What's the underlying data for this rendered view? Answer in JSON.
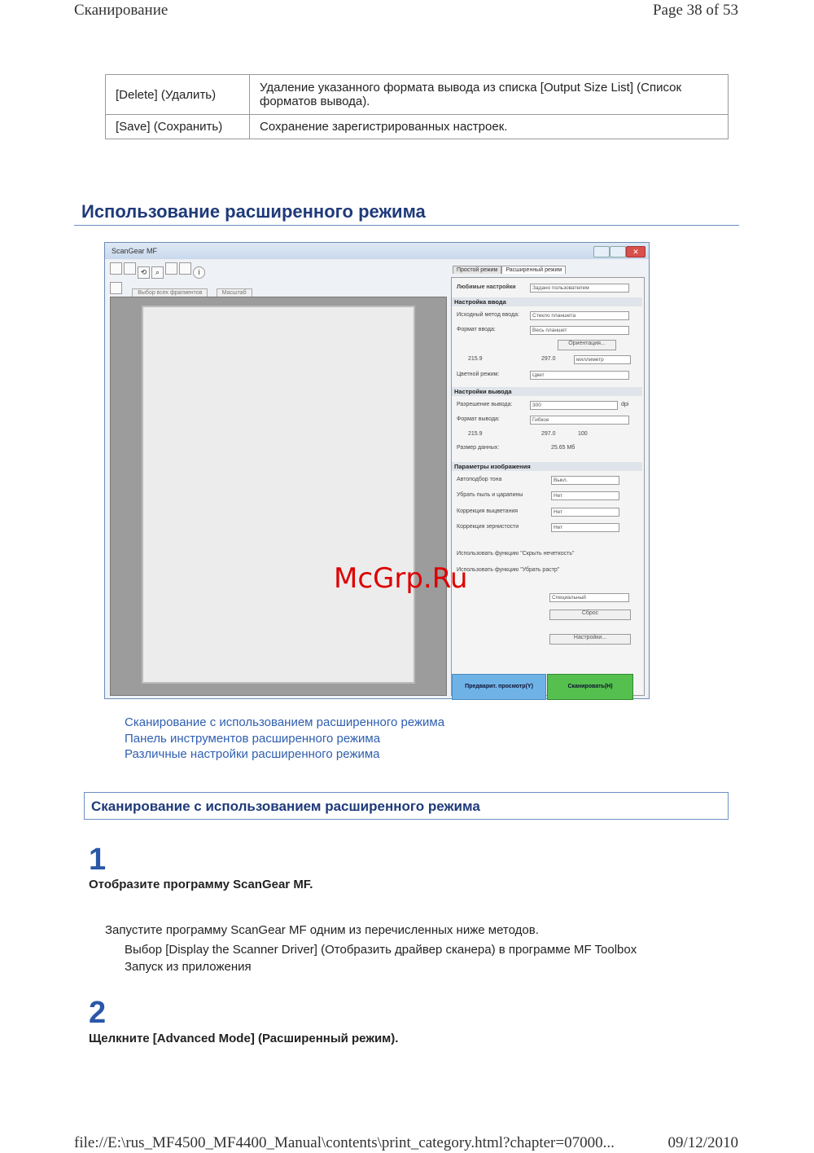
{
  "header": {
    "left": "Сканирование",
    "right": "Page 38 of 53"
  },
  "options_table": [
    {
      "name": "[Delete] (Удалить)",
      "desc": "Удаление указанного формата вывода из списка [Output Size List] (Список форматов вывода)."
    },
    {
      "name": "[Save] (Сохранить)",
      "desc": "Сохранение зарегистрированных настроек."
    }
  ],
  "section_title": "Использование расширенного режима",
  "window": {
    "title": "ScanGear MF",
    "toolbar2": [
      "Выбор всех фрагментов",
      "Масштаб"
    ],
    "tabs": [
      "Простой режим",
      "Расширенный режим"
    ],
    "fav_label": "Любимые настройки",
    "fav_value": "Задано пользователем",
    "input_group": "Настройка ввода",
    "input_method_label": "Исходный метод ввода:",
    "input_method_value": "Стекло планшета",
    "input_size_label": "Формат ввода:",
    "input_size_value": "Весь планшет",
    "orientation_btn": "Ориентация...",
    "width_in": "215.9",
    "height_in": "297.0",
    "unit_value": "миллиметр",
    "color_mode_label": "Цветной режим:",
    "color_mode_value": "Цвет",
    "output_group": "Настройки вывода",
    "res_label": "Разрешение вывода:",
    "res_value": "300",
    "res_unit": "dpi",
    "out_size_label": "Формат вывода:",
    "out_size_value": "Гибкое",
    "width_out": "215.9",
    "height_out": "297.0",
    "scale_value": "100",
    "data_size_label": "Размер данных:",
    "data_size_value": "25.65 Мб",
    "image_group": "Параметры изображения",
    "auto_tone_label": "Автоподбор тона",
    "auto_tone_value": "Выкл.",
    "descreen_label": "Убрать пыль и царапины",
    "descreen_value": "Нет",
    "fade_label": "Коррекция выцветания",
    "fade_value": "Нет",
    "grain_label": "Коррекция зернистости",
    "grain_value": "Нет",
    "unsharp_label": "Использовать функцию \"Скрыть нечеткость\"",
    "descreen2_label": "Использовать функцию \"Убрать растр\"",
    "tone_value": "Специальный",
    "reset_btn": "Сброс",
    "settings_btn": "Настройки...",
    "preview_btn": "Предварит. просмотр(Y)",
    "scan_btn": "Сканировать(H)"
  },
  "watermark": "McGrp.Ru",
  "links": [
    "Сканирование с использованием расширенного режима",
    "Панель инструментов расширенного режима",
    "Различные настройки расширенного режима"
  ],
  "subsection_title": "Сканирование с использованием расширенного режима",
  "steps": [
    {
      "num": "1",
      "head": "Отобразите программу ScanGear MF.",
      "body": "Запустите программу ScanGear MF одним из перечисленных ниже методов.",
      "items": [
        "Выбор [Display the Scanner Driver] (Отобразить драйвер сканера) в программе MF Toolbox",
        "Запуск из приложения"
      ]
    },
    {
      "num": "2",
      "head": "Щелкните [Advanced Mode] (Расширенный режим)."
    }
  ],
  "footer": {
    "left": "file://E:\\rus_MF4500_MF4400_Manual\\contents\\print_category.html?chapter=07000...",
    "right": "09/12/2010"
  }
}
